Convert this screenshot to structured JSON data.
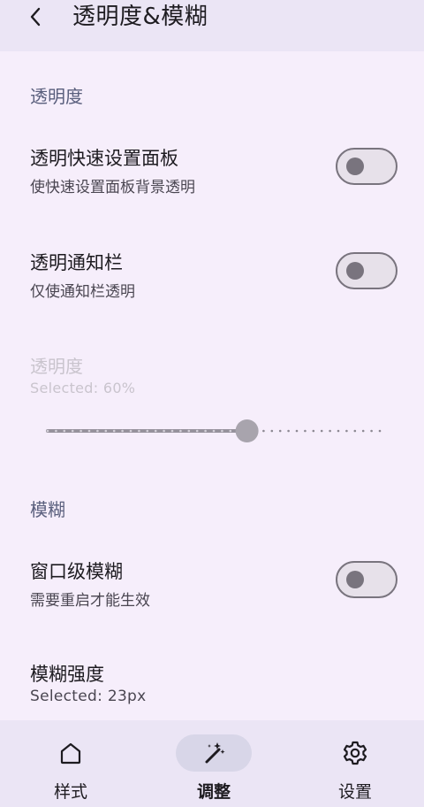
{
  "header": {
    "title": "透明度&模糊",
    "back_icon": "chevron-left-icon"
  },
  "sections": {
    "transparency": "透明度",
    "blur": "模糊"
  },
  "settings": {
    "qs_panel": {
      "title": "透明快速设置面板",
      "subtitle": "使快速设置面板背景透明",
      "enabled": false
    },
    "notification_bar": {
      "title": "透明通知栏",
      "subtitle": "仅使通知栏透明",
      "enabled": false
    },
    "opacity": {
      "title": "透明度",
      "subtitle": "Selected: 60%",
      "value": 60,
      "disabled": true
    },
    "window_blur": {
      "title": "窗口级模糊",
      "subtitle": "需要重启才能生效",
      "enabled": false
    },
    "blur_strength": {
      "title": "模糊强度",
      "subtitle": "Selected: 23px"
    }
  },
  "bottom_nav": {
    "items": [
      {
        "label": "样式",
        "icon": "home-icon",
        "active": false
      },
      {
        "label": "调整",
        "icon": "magic-wand-icon",
        "active": true
      },
      {
        "label": "设置",
        "icon": "gear-icon",
        "active": false
      }
    ]
  },
  "colors": {
    "background": "#f6eefb",
    "bar": "#ebe5f5",
    "active_indicator": "#d8d6e8",
    "section_title": "#5a5f7d",
    "switch_outline": "#79747e"
  }
}
